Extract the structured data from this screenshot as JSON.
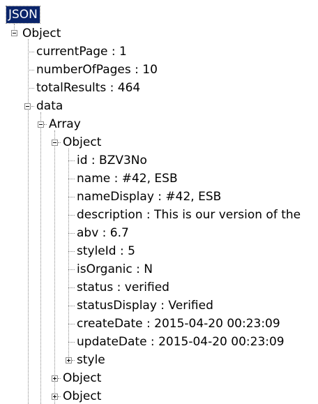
{
  "tree": {
    "root": "JSON",
    "object": "Object",
    "currentPage": "currentPage : 1",
    "numberOfPages": "numberOfPages : 10",
    "totalResults": "totalResults : 464",
    "data": "data",
    "array": "Array",
    "item": {
      "label": "Object",
      "fields": [
        "id : BZV3No",
        "name : #42, ESB",
        "nameDisplay : #42, ESB",
        "description : This is our version of the",
        "abv : 6.7",
        "styleId : 5",
        "isOrganic : N",
        "status : verified",
        "statusDisplay : Verified",
        "createDate : 2015-04-20 00:23:09",
        "updateDate : 2015-04-20 00:23:09"
      ],
      "style": "style"
    },
    "item2": "Object",
    "item3": "Object"
  }
}
